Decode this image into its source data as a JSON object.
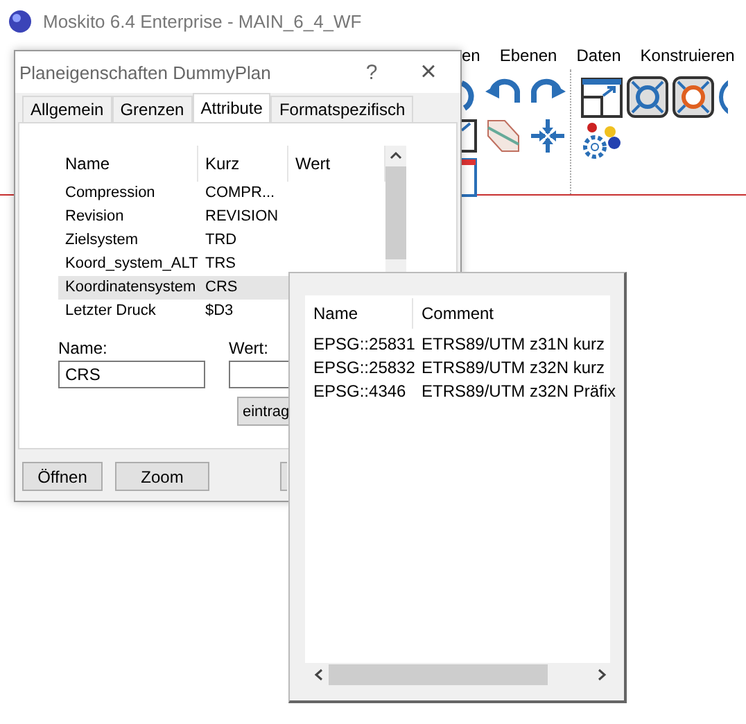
{
  "window": {
    "title": "Moskito 6.4 Enterprise - MAIN_6_4_WF"
  },
  "menu": [
    {
      "label": "en"
    },
    {
      "label": "Ebenen"
    },
    {
      "label": "Daten"
    },
    {
      "label": "Konstruieren"
    }
  ],
  "dialog": {
    "title": "Planeigenschaften DummyPlan",
    "help": "?",
    "close": "×",
    "tabs": [
      {
        "label": "Allgemein",
        "selected": false
      },
      {
        "label": "Grenzen",
        "selected": false
      },
      {
        "label": "Attribute",
        "selected": true
      },
      {
        "label": "Formatspezifisch",
        "selected": false
      }
    ],
    "columns": [
      "Name",
      "Kurz",
      "Wert"
    ],
    "rows": [
      {
        "name": "Compression",
        "short": "COMPR...",
        "selected": false
      },
      {
        "name": "Revision",
        "short": "REVISION",
        "selected": false
      },
      {
        "name": "Zielsystem",
        "short": "TRD",
        "selected": false
      },
      {
        "name": "Koord_system_ALT",
        "short": "TRS",
        "selected": false
      },
      {
        "name": "Koordinatensystem",
        "short": "CRS",
        "selected": true
      },
      {
        "name": "Letzter Druck",
        "short": "$D3",
        "selected": false
      }
    ],
    "name_field": {
      "label": "Name:",
      "value": "CRS"
    },
    "value_field": {
      "label": "Wert:"
    },
    "enter_button": "eintrag",
    "buttons": [
      "Öffnen",
      "Zoom"
    ]
  },
  "popup": {
    "columns": [
      "Name",
      "Comment"
    ],
    "rows": [
      {
        "name": "EPSG::25831",
        "comment": "ETRS89/UTM z31N kurz"
      },
      {
        "name": "EPSG::25832",
        "comment": "ETRS89/UTM z32N kurz"
      },
      {
        "name": "EPSG::4346",
        "comment": "ETRS89/UTM z32N Präfix"
      }
    ]
  }
}
